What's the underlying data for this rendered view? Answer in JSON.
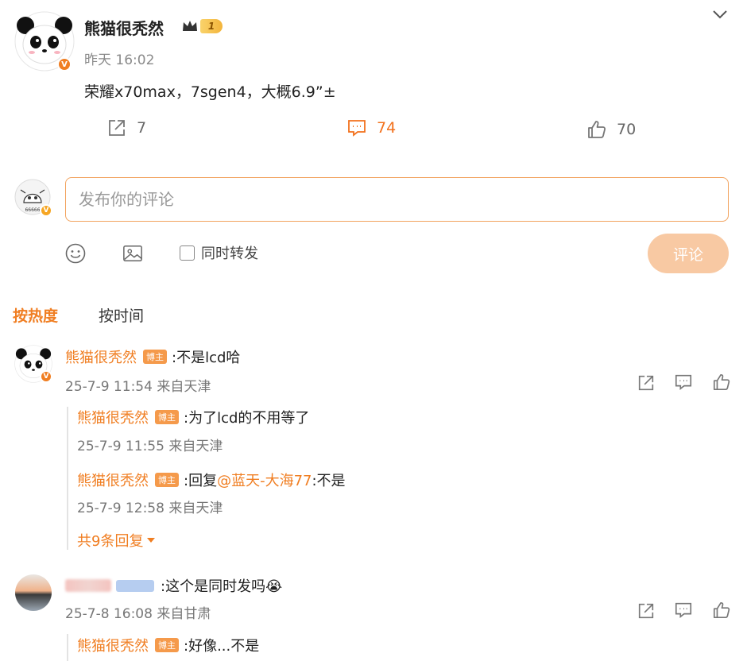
{
  "post": {
    "author": "熊猫很秃然",
    "level_badge": "1",
    "time": "昨天 16:02",
    "body": "荣耀x70max，7sgen4，大概6.9”±",
    "repost_count": "7",
    "comment_count": "74",
    "like_count": "70"
  },
  "composer": {
    "placeholder": "发布你的评论",
    "repost_label": "同时转发",
    "submit_label": "评论"
  },
  "sort": {
    "hot_label": "按热度",
    "time_label": "按时间"
  },
  "host_badge": "博主",
  "comments": [
    {
      "name": "熊猫很秃然",
      "text": ":不是lcd哈",
      "meta": "25-7-9 11:54 来自天津",
      "replies": [
        {
          "name": "熊猫很秃然",
          "text": ":为了lcd的不用等了",
          "meta": "25-7-9 11:55 来自天津"
        },
        {
          "name": "熊猫很秃然",
          "prefix": ":回复",
          "mention": "@蓝天-大海77",
          "suffix": ":不是",
          "meta": "25-7-9 12:58 来自天津"
        }
      ],
      "more_label": "共9条回复"
    },
    {
      "text": ":这个是同时发吗😭",
      "meta": "25-7-8 16:08 来自甘肃",
      "replies": [
        {
          "name": "熊猫很秃然",
          "text": ":好像...不是"
        }
      ]
    }
  ],
  "colors": {
    "accent": "#f07e22",
    "badge": "#f59a4b",
    "submit_disabled": "#f8c9a3"
  }
}
